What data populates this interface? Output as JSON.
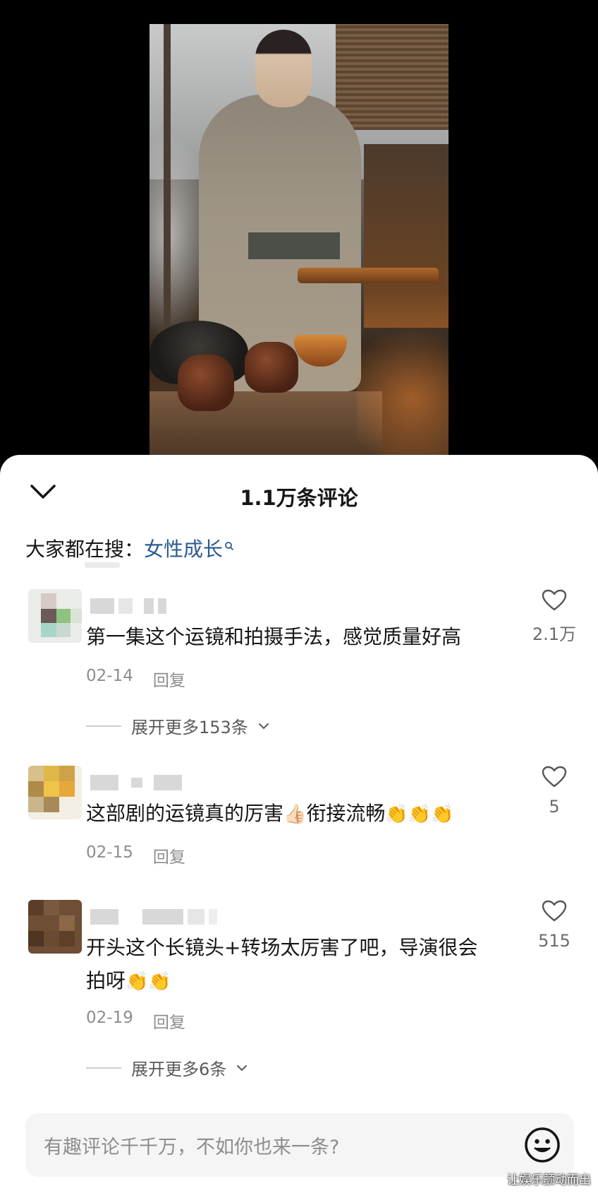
{
  "video": {
    "alt": "video frame"
  },
  "sheet": {
    "title": "1.1万条评论",
    "search_hint_label": "大家都在搜：",
    "search_hint_keyword": "女性成长"
  },
  "comments": [
    {
      "text": "第一集这个运镜和拍摄手法，感觉质量好高",
      "date": "02-14",
      "reply": "回复",
      "likes": "2.1万",
      "expand": "展开更多153条"
    },
    {
      "text": "这部剧的运镜真的厉害👍🏻衔接流畅👏👏👏",
      "text_main": "这部剧的运镜真的厉害",
      "text_mid": "衔接流畅",
      "date": "02-15",
      "reply": "回复",
      "likes": "5"
    },
    {
      "text": "开头这个长镜头+转场太厉害了吧，导演很会拍呀👏👏",
      "text_line1": "开头这个长镜头+转场太厉害了吧，导演很会",
      "text_line2": "拍呀",
      "date": "02-19",
      "reply": "回复",
      "likes": "515",
      "expand": "展开更多6条"
    }
  ],
  "input": {
    "placeholder": "有趣评论千千万，不如你也来一条?"
  },
  "watermark": "让娱乐颤动而出",
  "colors": {
    "keyword": "#2a5a8f",
    "muted": "#8d8d8d",
    "text": "#161616"
  }
}
